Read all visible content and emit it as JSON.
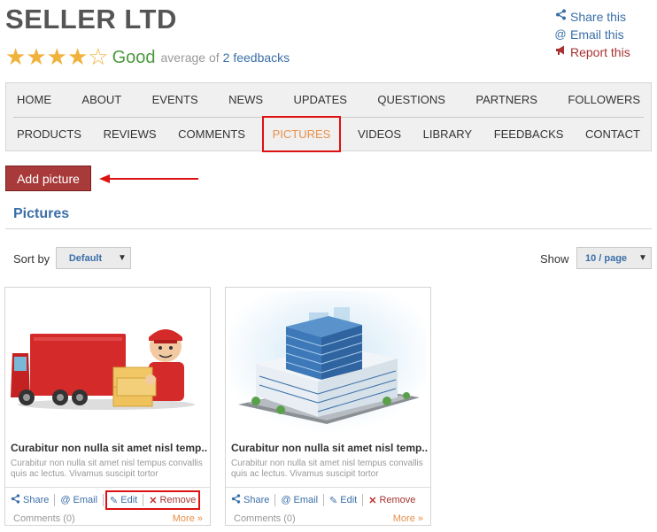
{
  "header": {
    "title": "SELLER LTD",
    "rating": {
      "stars": 4,
      "max_stars": 5,
      "word": "Good",
      "avg_text": "average of",
      "feedback_link": "2 feedbacks"
    },
    "actions": {
      "share": "Share this",
      "email": "Email this",
      "report": "Report this"
    }
  },
  "nav": {
    "row1": [
      "HOME",
      "ABOUT",
      "EVENTS",
      "NEWS",
      "UPDATES",
      "QUESTIONS",
      "PARTNERS",
      "FOLLOWERS"
    ],
    "row2": [
      "PRODUCTS",
      "REVIEWS",
      "COMMENTS",
      "PICTURES",
      "VIDEOS",
      "LIBRARY",
      "FEEDBACKS",
      "CONTACT"
    ],
    "active": "PICTURES"
  },
  "toolbar": {
    "add_label": "Add picture"
  },
  "section": {
    "title": "Pictures"
  },
  "controls": {
    "sort_label": "Sort by",
    "sort_value": "Default",
    "show_label": "Show",
    "show_value": "10 / page"
  },
  "cards": [
    {
      "image": "delivery-truck-courier",
      "title": "Curabitur non nulla sit amet nisl temp...",
      "description": "Curabitur non nulla sit amet nisl tempus convallis quis ac lectus. Vivamus suscipit tortor",
      "share": "Share",
      "email": "Email",
      "edit": "Edit",
      "remove": "Remove",
      "comments": "Comments (0)",
      "more": "More »"
    },
    {
      "image": "office-building",
      "title": "Curabitur non nulla sit amet nisl temp...",
      "description": "Curabitur non nulla sit amet nisl tempus convallis quis ac lectus. Vivamus suscipit tortor",
      "share": "Share",
      "email": "Email",
      "edit": "Edit",
      "remove": "Remove",
      "comments": "Comments (0)",
      "more": "More »"
    }
  ],
  "colors": {
    "accent_blue": "#3a6fa8",
    "button_red": "#a83a3a",
    "star_gold": "#f0b23a",
    "good_green": "#4a9a3e",
    "active_orange": "#e8904a",
    "highlight_red": "#dd1111"
  }
}
